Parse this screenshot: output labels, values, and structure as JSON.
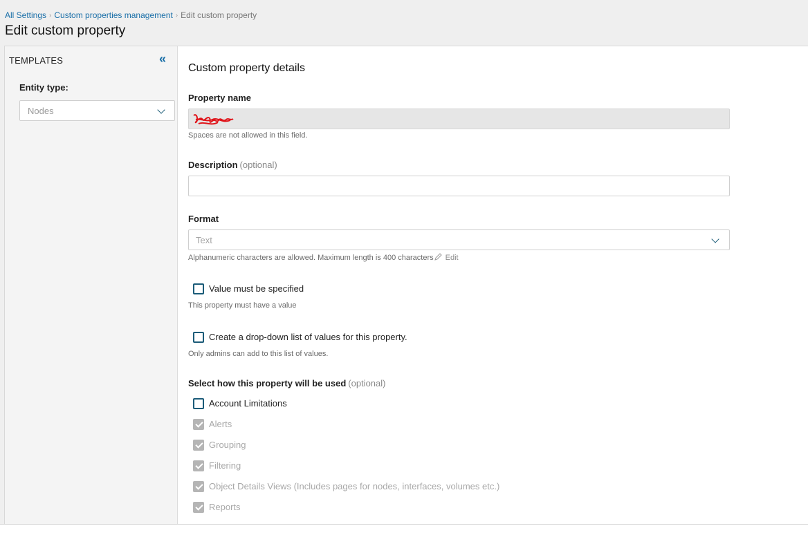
{
  "breadcrumb": {
    "items": [
      "All Settings",
      "Custom properties management",
      "Edit custom property"
    ]
  },
  "page": {
    "title": "Edit custom property"
  },
  "sidebar": {
    "title": "TEMPLATES",
    "entity_label": "Entity type:",
    "entity_value": "Nodes"
  },
  "form": {
    "section_title": "Custom property details",
    "property_name": {
      "label": "Property name",
      "value": "",
      "hint": "Spaces are not allowed in this field."
    },
    "description": {
      "label": "Description",
      "optional": "(optional)",
      "value": ""
    },
    "format": {
      "label": "Format",
      "value": "Text",
      "hint": "Alphanumeric characters are allowed. Maximum length is 400 characters",
      "edit": "Edit"
    },
    "value_required": {
      "label": "Value must be specified",
      "checked": false,
      "hint": "This property must have a value"
    },
    "dropdown_list": {
      "label": "Create a drop-down list of values for this property.",
      "checked": false,
      "hint": "Only admins can add to this list of values."
    },
    "usage": {
      "label": "Select how this property will be used",
      "optional": "(optional)",
      "items": [
        {
          "label": "Account Limitations",
          "checked": false,
          "disabled": false
        },
        {
          "label": "Alerts",
          "checked": true,
          "disabled": true
        },
        {
          "label": "Grouping",
          "checked": true,
          "disabled": true
        },
        {
          "label": "Filtering",
          "checked": true,
          "disabled": true
        },
        {
          "label": "Object Details Views (Includes pages for nodes, interfaces, volumes etc.)",
          "checked": true,
          "disabled": true
        },
        {
          "label": "Reports",
          "checked": true,
          "disabled": true
        }
      ]
    }
  },
  "colors": {
    "link": "#1a6fa8",
    "checkbox_border": "#1a5b78",
    "checked_disabled": "#b5b5b5"
  }
}
